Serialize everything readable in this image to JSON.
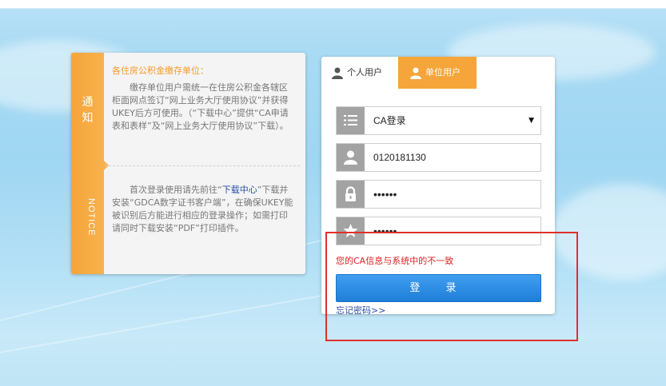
{
  "notice": {
    "side_label_cn": "通\n知",
    "side_label_en": "NOTICE",
    "title": "各住房公积金缴存单位：",
    "paragraph1": "缴存单位用户需统一在住房公积金各辖区柜面网点签订“网上业务大厅使用协议”并获得UKEY后方可使用。（“下载中心”提供“CA申请表和表样”及“网上业务大厅使用协议”下载）。",
    "paragraph2_before": "首次登录使用请先前往“",
    "paragraph2_link": "下载中心",
    "paragraph2_after": "”下载并安装“GDCA数字证书客户端”，在确保UKEY能被识别后方能进行相应的登录操作；如需打印请同时下载安装“PDF”打印插件。"
  },
  "login": {
    "tabs": [
      {
        "label": "个人用户",
        "active": false
      },
      {
        "label": "单位用户",
        "active": true
      }
    ],
    "login_type": {
      "value": "CA登录",
      "icon": "list-icon"
    },
    "username": {
      "value": "0120181130",
      "icon": "user-icon"
    },
    "password": {
      "value": "••••••",
      "icon": "lock-icon"
    },
    "ca_password": {
      "value": "••••••",
      "icon": "star-icon"
    },
    "error_message": "您的CA信息与系统中的不一致",
    "submit_label": "登 录",
    "forgot_label": "忘记密码>>"
  },
  "colors": {
    "accent_orange": "#f5a53a",
    "button_blue": "#2b8ee6",
    "error_red": "#e02020",
    "highlight_red": "#e0302a"
  }
}
